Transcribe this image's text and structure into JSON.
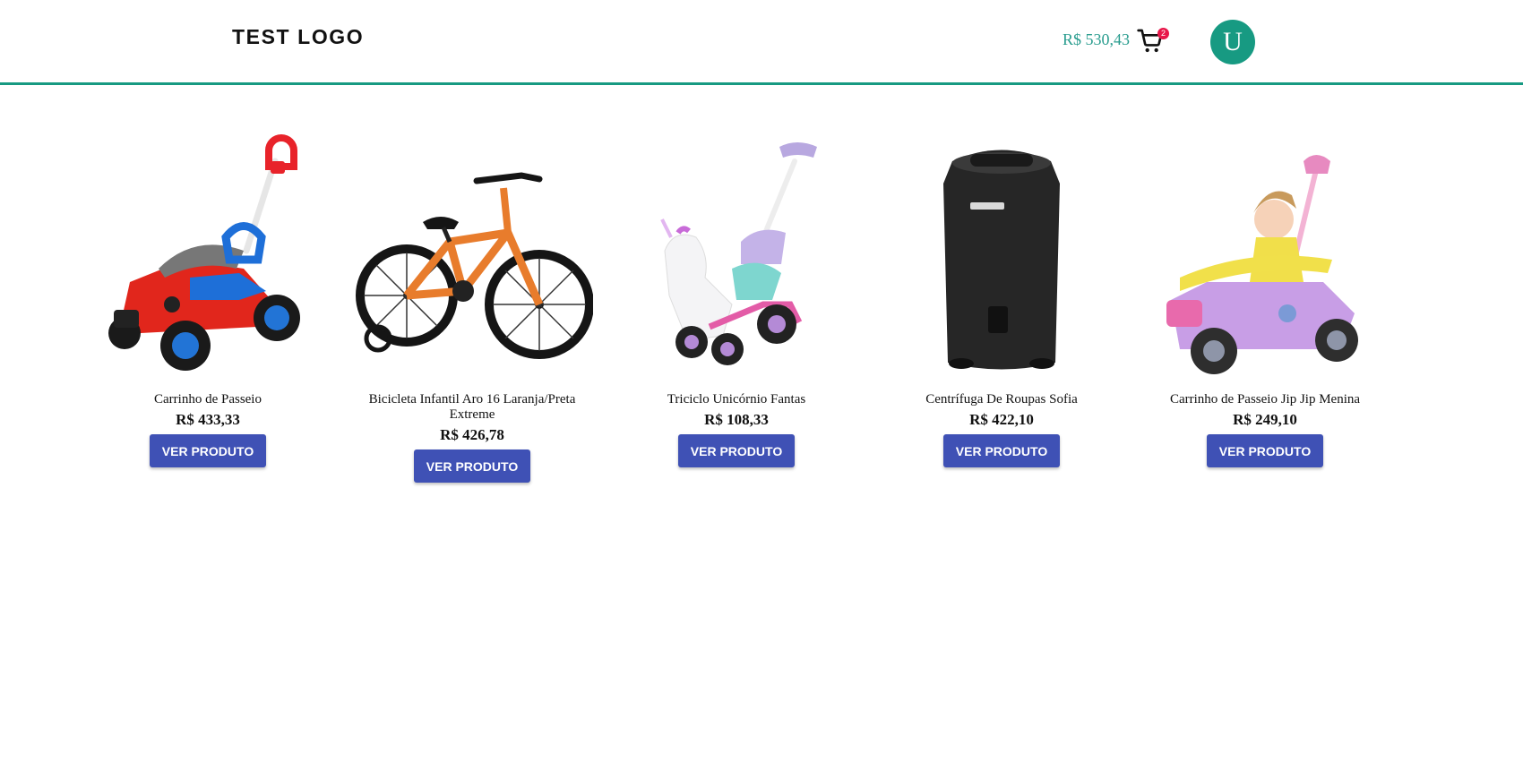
{
  "header": {
    "logo": "TEST LOGO",
    "cart_total": "R$ 530,43",
    "cart_count": "2",
    "cart_icon": "shopping-cart-icon",
    "avatar_initial": "U"
  },
  "colors": {
    "accent": "#179a82",
    "button": "#3f51b5",
    "badge": "#e8174a"
  },
  "products": [
    {
      "name": "Carrinho de Passeio",
      "price": "R$ 433,33",
      "button": "VER PRODUTO"
    },
    {
      "name": "Bicicleta Infantil Aro 16 Laranja/Preta Extreme",
      "price": "R$ 426,78",
      "button": "VER PRODUTO"
    },
    {
      "name": "Triciclo Unicórnio Fantas",
      "price": "R$ 108,33",
      "button": "VER PRODUTO"
    },
    {
      "name": "Centrífuga De Roupas Sofia",
      "price": "R$ 422,10",
      "button": "VER PRODUTO"
    },
    {
      "name": "Carrinho de Passeio Jip Jip Menina",
      "price": "R$ 249,10",
      "button": "VER PRODUTO"
    }
  ]
}
